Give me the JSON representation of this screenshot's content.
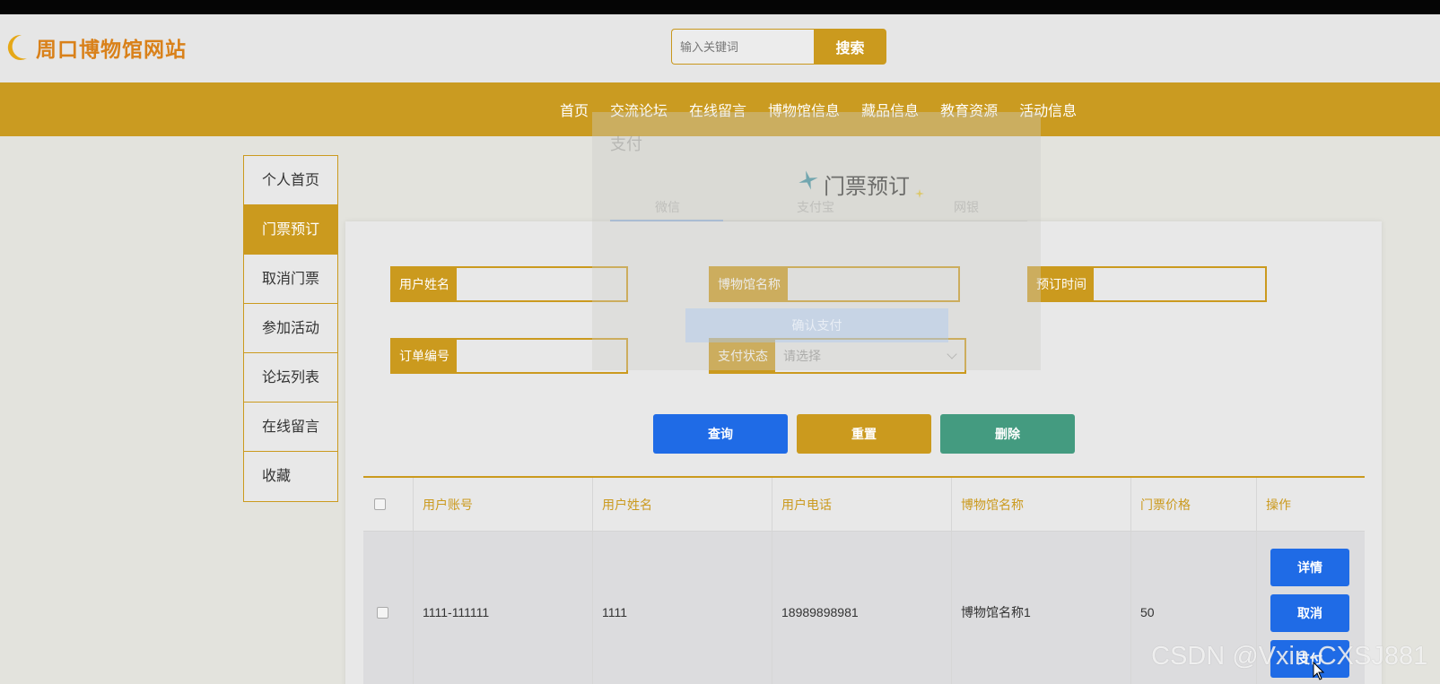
{
  "site": {
    "title": "周口博物馆网站",
    "brand_color": "#cb9a1e"
  },
  "search": {
    "placeholder": "输入关键词",
    "button": "搜索"
  },
  "nav": {
    "items": [
      "首页",
      "交流论坛",
      "在线留言",
      "博物馆信息",
      "藏品信息",
      "教育资源",
      "活动信息"
    ]
  },
  "sidebar": {
    "items": [
      "个人首页",
      "门票预订",
      "取消门票",
      "参加活动",
      "论坛列表",
      "在线留言",
      "收藏"
    ],
    "active": "门票预订"
  },
  "page": {
    "heading": "门票预订"
  },
  "filters": {
    "user_name_label": "用户姓名",
    "museum_name_label": "博物馆名称",
    "booking_time_label": "预订时间",
    "order_no_label": "订单编号",
    "pay_status_label": "支付状态",
    "pay_status_placeholder": "请选择"
  },
  "actions": {
    "query": "查询",
    "reset": "重置",
    "delete": "删除"
  },
  "table": {
    "columns": [
      "用户账号",
      "用户姓名",
      "用户电话",
      "博物馆名称",
      "门票价格",
      "操作"
    ],
    "rows": [
      {
        "account": "1111-111111",
        "name": "1111",
        "phone": "18989898981",
        "museum": "博物馆名称1",
        "price": "50",
        "buttons": [
          "详情",
          "取消",
          "支付"
        ]
      }
    ]
  },
  "pay_dialog": {
    "title": "支付",
    "tabs": [
      "微信",
      "支付宝",
      "网银"
    ],
    "confirm": "确认支付"
  },
  "watermark": "CSDN @Vxin-CXSJ881"
}
